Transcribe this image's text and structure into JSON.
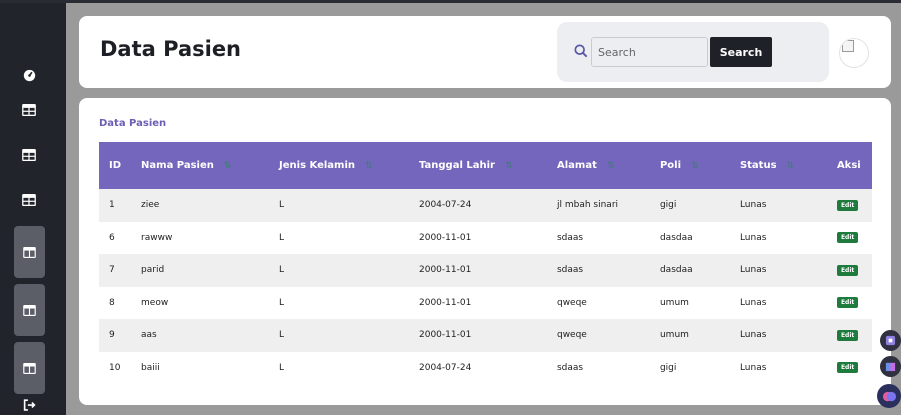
{
  "header": {
    "title": "Data Pasien",
    "search_placeholder": "Search",
    "search_button": "Search"
  },
  "breadcrumb": "Data Pasien",
  "table": {
    "columns": [
      "ID",
      "Nama Pasien",
      "Jenis Kelamin",
      "Tanggal Lahir",
      "Alamat",
      "Poli",
      "Status",
      "Aksi"
    ],
    "rows": [
      {
        "id": "1",
        "nama": "ziee",
        "jk": "L",
        "tgl": "2004-07-24",
        "alamat": "jl mbah sinari",
        "poli": "gigi",
        "status": "Lunas",
        "aksi": "Edit"
      },
      {
        "id": "6",
        "nama": "rawww",
        "jk": "L",
        "tgl": "2000-11-01",
        "alamat": "sdaas",
        "poli": "dasdaa",
        "status": "Lunas",
        "aksi": "Edit"
      },
      {
        "id": "7",
        "nama": "parid",
        "jk": "L",
        "tgl": "2000-11-01",
        "alamat": "sdaas",
        "poli": "dasdaa",
        "status": "Lunas",
        "aksi": "Edit"
      },
      {
        "id": "8",
        "nama": "meow",
        "jk": "L",
        "tgl": "2000-11-01",
        "alamat": "qweqe",
        "poli": "umum",
        "status": "Lunas",
        "aksi": "Edit"
      },
      {
        "id": "9",
        "nama": "aas",
        "jk": "L",
        "tgl": "2000-11-01",
        "alamat": "qweqe",
        "poli": "umum",
        "status": "Lunas",
        "aksi": "Edit"
      },
      {
        "id": "10",
        "nama": "baiii",
        "jk": "L",
        "tgl": "2004-07-24",
        "alamat": "sdaas",
        "poli": "gigi",
        "status": "Lunas",
        "aksi": "Edit"
      }
    ]
  },
  "sort_glyph": "⇅",
  "icons": {
    "sidebar": [
      "dashboard-icon",
      "table-icon",
      "table-icon",
      "table-icon",
      "layout-icon",
      "layout-icon",
      "layout-icon",
      "logout-icon"
    ]
  },
  "colors": {
    "table_header": "#7466bd",
    "accent_text": "#6c5fb3",
    "edit_button": "#1f7a3e",
    "search_button": "#1f2129"
  }
}
